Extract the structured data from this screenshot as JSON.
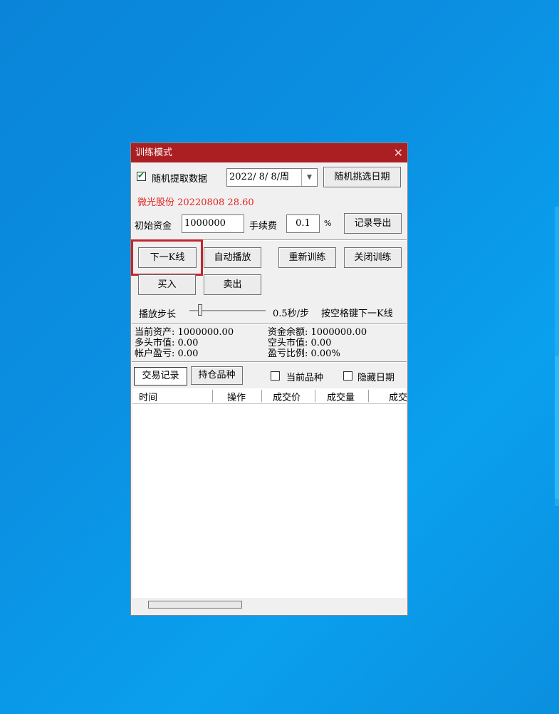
{
  "dialog": {
    "title": "训练模式",
    "close_glyph": "✕"
  },
  "row1": {
    "random_checkbox_checked": true,
    "random_label": "随机提取数据",
    "date_value": "2022/ 8/ 8/周",
    "random_date_button": "随机挑选日期"
  },
  "stock_line": "微光股份 20220808 28.60",
  "row3": {
    "capital_label": "初始资金",
    "capital_value": "1000000",
    "fee_label": "手续费",
    "fee_value": "0.1",
    "fee_unit": "%",
    "export_button": "记录导出"
  },
  "controls": {
    "next_k": "下一K线",
    "auto_play": "自动播放",
    "retrain": "重新训练",
    "close_train": "关闭训练",
    "buy": "买入",
    "sell": "卖出"
  },
  "play": {
    "step_label": "播放步长",
    "speed_text": "0.5秒/步",
    "hint": "按空格键下一K线",
    "slider_level": 0.12
  },
  "stats": {
    "current_assets": "当前资产: 1000000.00",
    "long_value": "多头市值: 0.00",
    "account_pnl": "帐户盈亏: 0.00",
    "cash_balance": "资金余额: 1000000.00",
    "short_value": "空头市值: 0.00",
    "pnl_ratio": "盈亏比例: 0.00%"
  },
  "tabs": {
    "trade_record": "交易记录",
    "holdings": "持仓品种",
    "current_symbol_label": "当前品种",
    "current_symbol_checked": false,
    "hide_date_label": "隐藏日期",
    "hide_date_checked": false
  },
  "table": {
    "columns": [
      "时间",
      "操作",
      "成交价",
      "成交量",
      "成交"
    ],
    "rows": []
  },
  "colors": {
    "titlebar": "#ab1e22",
    "highlight": "#c1272d",
    "stock_text": "#e52222"
  }
}
